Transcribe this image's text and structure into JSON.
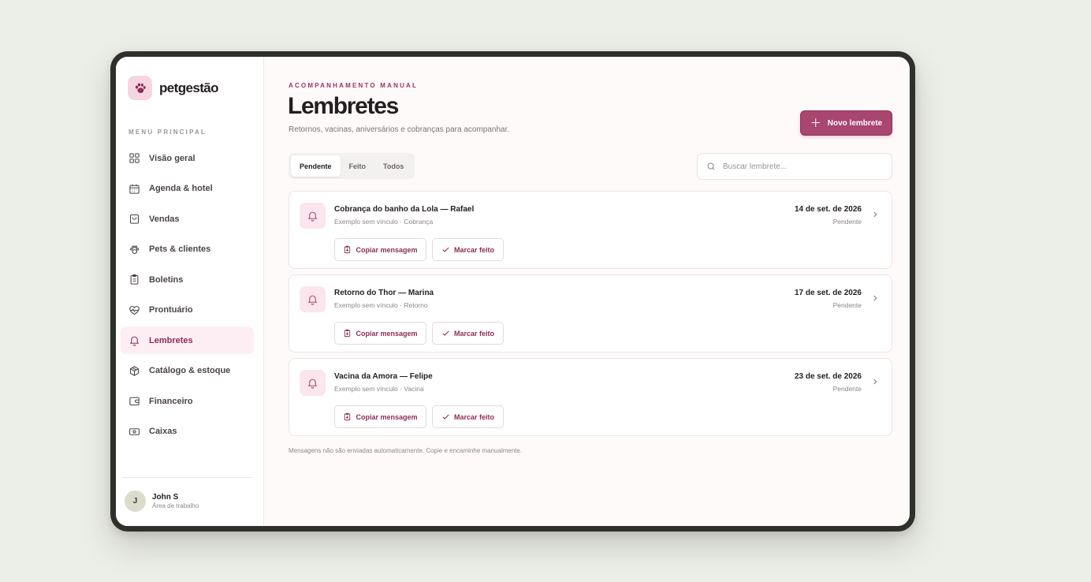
{
  "brand": {
    "name": "petgestão"
  },
  "sidebar": {
    "caption": "MENU PRINCIPAL",
    "items": [
      {
        "label": "Visão geral",
        "icon": "grid-icon"
      },
      {
        "label": "Agenda & hotel",
        "icon": "calendar-icon"
      },
      {
        "label": "Vendas",
        "icon": "shopping-bag-icon"
      },
      {
        "label": "Pets & clientes",
        "icon": "paw-icon"
      },
      {
        "label": "Boletins",
        "icon": "clipboard-icon"
      },
      {
        "label": "Prontuário",
        "icon": "heart-pulse-icon"
      },
      {
        "label": "Lembretes",
        "icon": "bell-icon",
        "active": true
      },
      {
        "label": "Catálogo & estoque",
        "icon": "package-icon"
      },
      {
        "label": "Financeiro",
        "icon": "wallet-icon"
      },
      {
        "label": "Caixas",
        "icon": "cash-icon"
      }
    ],
    "user": {
      "initial": "J",
      "name": "John S",
      "role": "Área de trabalho"
    }
  },
  "header": {
    "eyebrow": "ACOMPANHAMENTO MANUAL",
    "title": "Lembretes",
    "subtitle": "Retornos, vacinas, aniversários e cobranças para acompanhar.",
    "new_button": "Novo lembrete"
  },
  "tabs": [
    {
      "label": "Pendente",
      "active": true
    },
    {
      "label": "Feito"
    },
    {
      "label": "Todos"
    }
  ],
  "search": {
    "placeholder": "Buscar lembrete...",
    "value": ""
  },
  "reminders": [
    {
      "title": "Cobrança do banho da Lola — Rafael",
      "meta": "Exemplo sem vínculo · Cobrança",
      "date": "14 de set. de 2026",
      "status": "Pendente",
      "copy_label": "Copiar mensagem",
      "done_label": "Marcar feito"
    },
    {
      "title": "Retorno do Thor — Marina",
      "meta": "Exemplo sem vínculo · Retorno",
      "date": "17 de set. de 2026",
      "status": "Pendente",
      "copy_label": "Copiar mensagem",
      "done_label": "Marcar feito"
    },
    {
      "title": "Vacina da Amora — Felipe",
      "meta": "Exemplo sem vínculo · Vacina",
      "date": "23 de set. de 2026",
      "status": "Pendente",
      "copy_label": "Copiar mensagem",
      "done_label": "Marcar feito"
    }
  ],
  "footnote": "Mensagens não são enviadas automaticamente. Copie e encaminhe manualmente.",
  "colors": {
    "accent": "#a8466f",
    "accent_dark": "#8d2d57",
    "accent_soft": "#fbe6ee",
    "page_bg": "#eceee8"
  }
}
